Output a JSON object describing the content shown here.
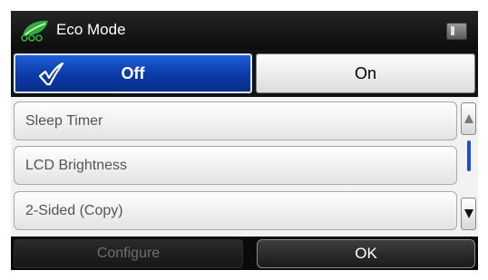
{
  "header": {
    "title": "Eco Mode",
    "icon": "leaf-icon",
    "status_icon": "memory-card-icon"
  },
  "mode_toggle": {
    "options": [
      {
        "label": "Off",
        "selected": true
      },
      {
        "label": "On",
        "selected": false
      }
    ],
    "check_icon": "checkmark-icon",
    "selected_color": "#0a3aa6"
  },
  "settings_list": {
    "items": [
      {
        "label": "Sleep Timer"
      },
      {
        "label": "LCD Brightness"
      },
      {
        "label": "2-Sided (Copy)"
      }
    ]
  },
  "scrollbar": {
    "up_icon": "scroll-up-arrow-icon",
    "down_icon": "scroll-down-arrow-icon",
    "thumb_color": "#1b4fd0"
  },
  "footer": {
    "configure_label": "Configure",
    "ok_label": "OK"
  }
}
